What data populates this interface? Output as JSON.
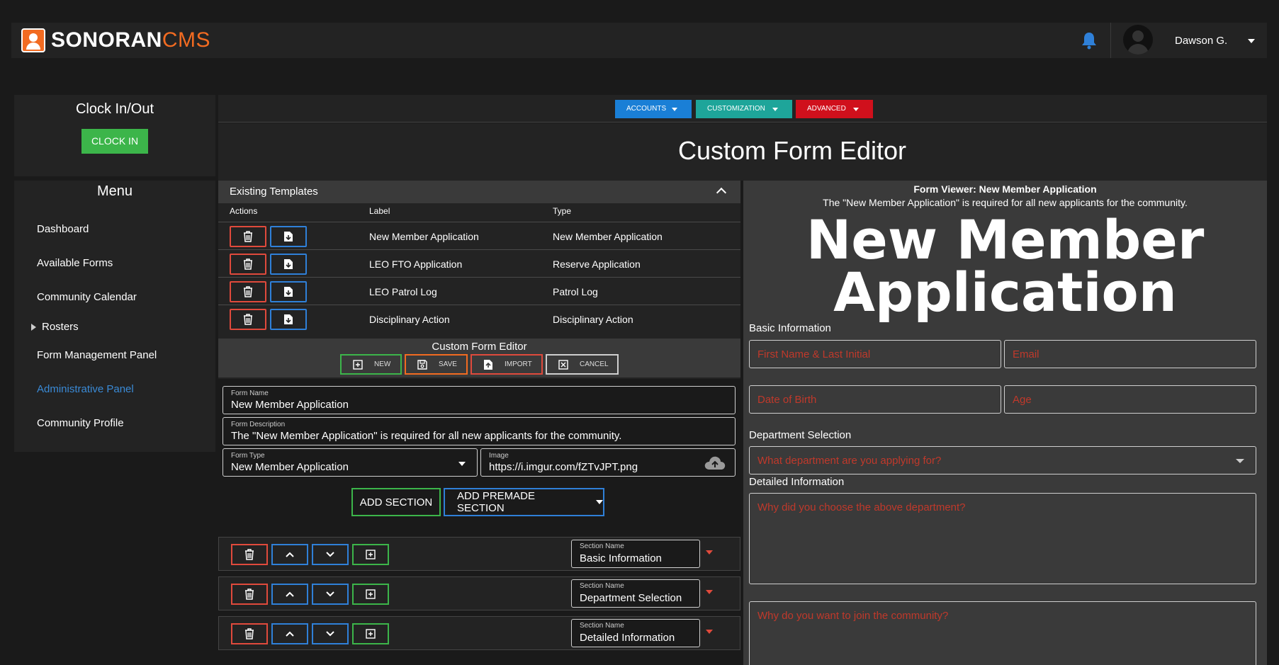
{
  "header": {
    "logo_main": "SONORAN",
    "logo_accent": "CMS",
    "username": "Dawson G."
  },
  "clock": {
    "title": "Clock In/Out",
    "button": "CLOCK IN"
  },
  "menu": {
    "title": "Menu",
    "items": [
      {
        "label": "Dashboard"
      },
      {
        "label": "Available Forms"
      },
      {
        "label": "Community Calendar"
      },
      {
        "label": "Rosters"
      },
      {
        "label": "Form Management Panel"
      },
      {
        "label": "Administrative Panel"
      },
      {
        "label": "Community Profile"
      }
    ]
  },
  "topnav": {
    "accounts": "ACCOUNTS",
    "customization": "CUSTOMIZATION",
    "advanced": "ADVANCED",
    "colors": {
      "accounts": "#1a7fd6",
      "customization": "#1ea59a",
      "advanced": "#d0101c"
    }
  },
  "page": {
    "title": "Custom Form Editor"
  },
  "templates": {
    "heading": "Existing Templates",
    "columns": [
      "Actions",
      "Label",
      "Type"
    ],
    "rows": [
      {
        "label": "New Member Application",
        "type": "New Member Application"
      },
      {
        "label": "LEO FTO Application",
        "type": "Reserve Application"
      },
      {
        "label": "LEO Patrol Log",
        "type": "Patrol Log"
      },
      {
        "label": "Disciplinary Action",
        "type": "Disciplinary Action"
      }
    ]
  },
  "editor": {
    "title": "Custom Form Editor",
    "buttons": {
      "new": "NEW",
      "save": "SAVE",
      "import": "IMPORT",
      "cancel": "CANCEL"
    },
    "form_name_label": "Form Name",
    "form_name": "New Member Application",
    "form_desc_label": "Form Description",
    "form_desc": "The \"New Member Application\" is required for all new applicants for the community.",
    "form_type_label": "Form Type",
    "form_type": "New Member Application",
    "image_label": "Image",
    "image": "https://i.imgur.com/fZTvJPT.png",
    "add_section": "ADD SECTION",
    "add_premade": "ADD PREMADE SECTION",
    "section_name_label": "Section Name",
    "sections": [
      {
        "name": "Basic Information"
      },
      {
        "name": "Department Selection"
      },
      {
        "name": "Detailed Information"
      }
    ]
  },
  "viewer": {
    "title": "Form Viewer: New Member Application",
    "description": "The \"New Member Application\" is required for all new applicants for the community.",
    "big_line1": "New Member",
    "big_line2": "Application",
    "basic_label": "Basic Information",
    "ph_name": "First Name & Last Initial",
    "ph_email": "Email",
    "ph_dob": "Date of Birth",
    "ph_age": "Age",
    "dept_label": "Department Selection",
    "ph_dept": "What department are you applying for?",
    "detail_label": "Detailed Information",
    "ph_why_dept": "Why did you choose the above department?",
    "ph_why_join": "Why do you want to join the community?"
  }
}
